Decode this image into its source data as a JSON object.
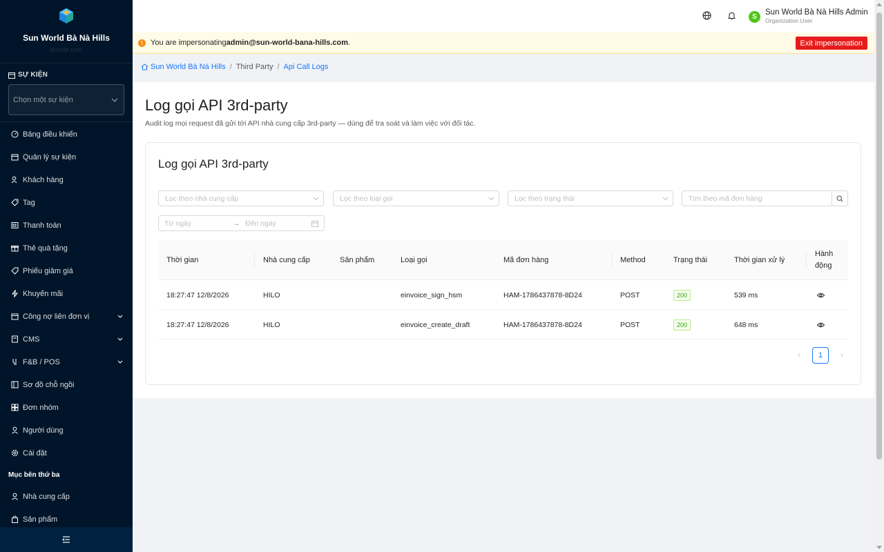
{
  "sidebar": {
    "brand_name": "Sun World Bà Nà Hills",
    "brand_sub": "private.com",
    "event_section_label": "SỰ KIỆN",
    "event_select_placeholder": "Chọn một sự kiện",
    "items": [
      {
        "label": "Bảng điều khiển",
        "icon": "dashboard-icon"
      },
      {
        "label": "Quản lý sự kiện",
        "icon": "calendar-icon"
      },
      {
        "label": "Khách hàng",
        "icon": "user-heart-icon"
      },
      {
        "label": "Tag",
        "icon": "tag-icon"
      },
      {
        "label": "Thanh toán",
        "icon": "payment-icon"
      },
      {
        "label": "Thẻ quà tặng",
        "icon": "gift-icon"
      },
      {
        "label": "Phiếu giảm giá",
        "icon": "coupon-icon"
      },
      {
        "label": "Khuyến mãi",
        "icon": "thunderbolt-icon"
      },
      {
        "label": "Công nợ liên đơn vị",
        "icon": "debt-icon"
      },
      {
        "label": "CMS",
        "icon": "cms-icon"
      },
      {
        "label": "F&B / POS",
        "icon": "fnb-icon"
      },
      {
        "label": "Sơ đồ chỗ ngồi",
        "icon": "seatmap-icon"
      },
      {
        "label": "Đơn nhóm",
        "icon": "group-order-icon"
      },
      {
        "label": "Người dùng",
        "icon": "user-icon"
      },
      {
        "label": "Cài đặt",
        "icon": "gear-icon"
      }
    ],
    "third_party_group_label": "Mục bên thứ ba",
    "third_party_items": [
      {
        "label": "Nhà cung cấp",
        "icon": "user-icon"
      },
      {
        "label": "Sản phẩm",
        "icon": "bag-icon"
      }
    ]
  },
  "header": {
    "avatar_letter": "S",
    "user_name": "Sun World Bà Nà Hills Admin",
    "user_role": "Organization User"
  },
  "banner": {
    "prefix": "You are impersonating ",
    "email": "admin@sun-world-bana-hills.com",
    "suffix": ".",
    "exit_label": "Exit impersonation"
  },
  "breadcrumb": {
    "home": "Sun World Bà Nà Hills",
    "middle": "Third Party",
    "current": "Api Call Logs"
  },
  "page": {
    "title": "Log gọi API 3rd-party",
    "description": "Audit log mọi request đã gửi tới API nhà cung cấp 3rd-party — dùng để tra soát và làm việc với đối tác."
  },
  "card": {
    "title": "Log gọi API 3rd-party"
  },
  "filters": {
    "provider_placeholder": "Lọc theo nhà cung cấp",
    "call_type_placeholder": "Lọc theo loại gọi",
    "status_placeholder": "Lọc theo trạng thái",
    "order_search_placeholder": "Tìm theo mã đơn hàng",
    "from_date_placeholder": "Từ ngày",
    "to_date_placeholder": "Đến ngày"
  },
  "table": {
    "columns": {
      "time": "Thời gian",
      "provider": "Nhà cung cấp",
      "product": "Sản phẩm",
      "call_type": "Loại gọi",
      "order_code": "Mã đơn hàng",
      "method": "Method",
      "status": "Trạng thái",
      "duration": "Thời gian xử lý",
      "action_line1": "Hành",
      "action_line2": "động"
    },
    "rows": [
      {
        "time": "18:27:47 12/8/2026",
        "provider": "HILO",
        "product": "",
        "call_type": "einvoice_sign_hsm",
        "order_code": "HAM-1786437878-8D24",
        "method": "POST",
        "status": "200",
        "duration": "539 ms"
      },
      {
        "time": "18:27:47 12/8/2026",
        "provider": "HILO",
        "product": "",
        "call_type": "einvoice_create_draft",
        "order_code": "HAM-1786437878-8D24",
        "method": "POST",
        "status": "200",
        "duration": "648 ms"
      }
    ]
  },
  "pagination": {
    "current_page": "1"
  },
  "colors": {
    "sidebar_bg": "#001529",
    "primary": "#1677ff",
    "danger": "#e61c1c",
    "success": "#52c41a",
    "warning": "#fa8c16"
  }
}
